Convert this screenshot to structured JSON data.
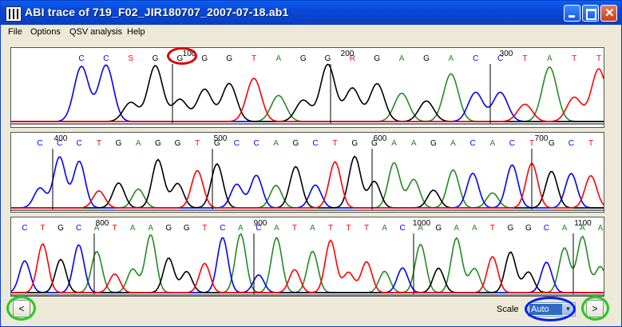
{
  "window": {
    "title": "ABI trace of 719_F02_JIR180707_2007-07-18.ab1"
  },
  "menu": [
    "File",
    "Options",
    "QSV analysis",
    "Help"
  ],
  "colors": {
    "A": "#228b22",
    "C": "#0000ff",
    "G": "#000000",
    "T": "#ff0000",
    "R": "#ff0000",
    "S": "#ff0000",
    "ring_red": "#dd0000",
    "ring_green": "#22cc22",
    "ring_blue": "#0022ee"
  },
  "panels": [
    {
      "positions": [
        "100",
        "200",
        "300"
      ],
      "bases": "CCSGGGGTAGGRGAGACCTATT"
    },
    {
      "positions": [
        "400",
        "500",
        "600",
        "700"
      ],
      "bases": "CCCTGAGGTGCCAGCTGGAAGACACTGCT"
    },
    {
      "positions": [
        "800",
        "900",
        "1000",
        "1100"
      ],
      "bases": "CTGCATAAGGTCACATATTTACAGAATGGCAAA"
    }
  ],
  "controls": {
    "prev_label": "<",
    "next_label": ">",
    "scale_label": "Scale",
    "scale_value": "Auto"
  },
  "icons": {
    "prev": "chevron-left-icon",
    "next": "chevron-right-icon",
    "dropdown": "chevron-down-icon"
  }
}
